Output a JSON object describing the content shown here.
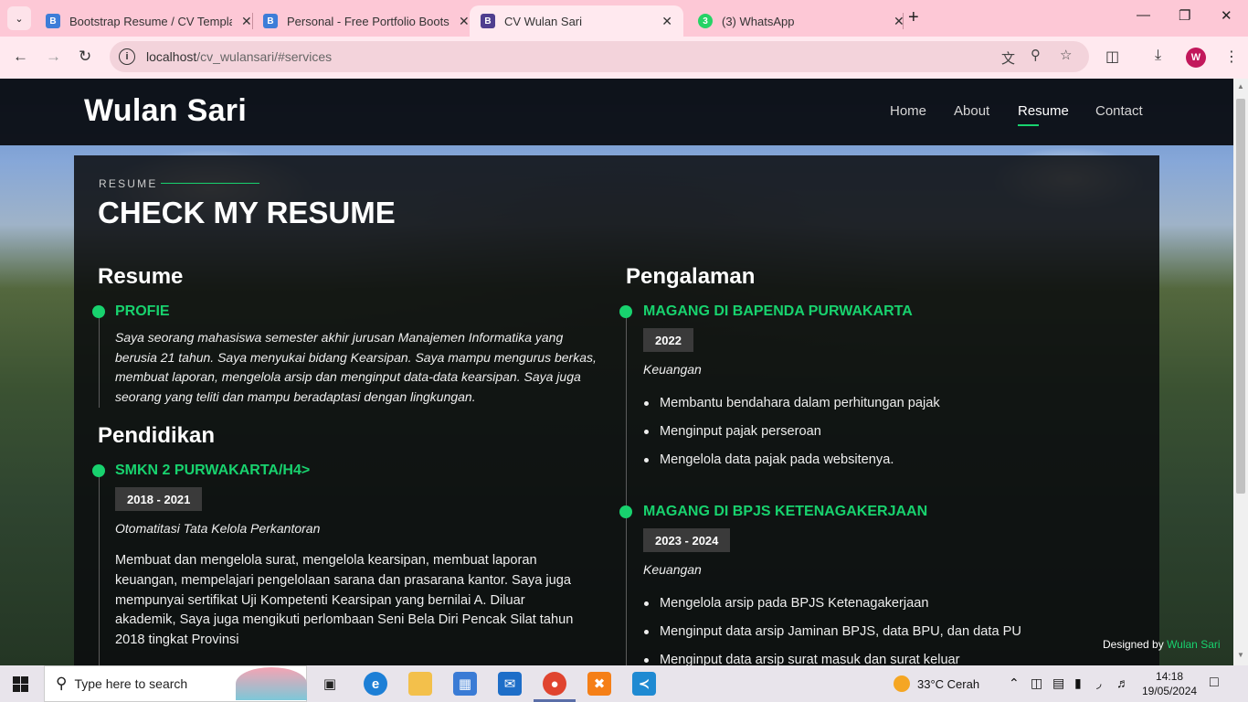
{
  "browser": {
    "tabs": [
      {
        "title": "Bootstrap Resume / CV Templat",
        "favicon": "B",
        "favicon_color": "#3d7dd8"
      },
      {
        "title": "Personal - Free Portfolio Bootst",
        "favicon": "B",
        "favicon_color": "#3d7dd8"
      },
      {
        "title": "CV Wulan Sari",
        "favicon": "B",
        "favicon_color": "#4f3e8f",
        "active": true
      },
      {
        "title": "(3) WhatsApp",
        "favicon": "3",
        "favicon_color": "#25d366"
      }
    ],
    "url_host": "localhost",
    "url_path": "/cv_wulansari/#services",
    "profile_initial": "W"
  },
  "site": {
    "logo": "Wulan Sari",
    "nav": [
      "Home",
      "About",
      "Resume",
      "Contact"
    ],
    "active_nav": "Resume",
    "accent_color": "#18d26e"
  },
  "resume": {
    "kicker": "RESUME",
    "title": "CHECK MY RESUME",
    "left": {
      "heading": "Resume",
      "profile": {
        "title": "PROFIE",
        "lines": [
          "Saya seorang mahasiswa semester akhir jurusan Manajemen Informatika yang",
          "berusia 21 tahun. Saya menyukai bidang Kearsipan. Saya mampu mengurus berkas,",
          "membuat laporan, mengelola arsip dan menginput data-data kearsipan. Saya juga",
          "seorang yang teliti dan mampu beradaptasi dengan lingkungan."
        ]
      },
      "education_heading": "Pendidikan",
      "education": {
        "title": "SMKN 2 PURWAKARTA/H4>",
        "date": "2018 - 2021",
        "subtitle": "Otomatitasi Tata Kelola Perkantoran",
        "lines": [
          "Membuat dan mengelola surat, mengelola kearsipan, membuat laporan",
          "keuangan, mempelajari pengelolaan sarana dan prasarana kantor. Saya juga",
          "mempunyai sertifikat Uji Kompetenti Kearsipan yang bernilai A. Diluar",
          "akademik, Saya juga mengikuti perlombaan Seni Bela Diri Pencak Silat tahun",
          "2018 tingkat Provinsi"
        ]
      }
    },
    "right": {
      "heading": "Pengalaman",
      "jobs": [
        {
          "title": "MAGANG DI BAPENDA PURWAKARTA",
          "date": "2022",
          "subtitle": "Keuangan",
          "bullets": [
            "Membantu bendahara dalam perhitungan pajak",
            "Menginput pajak perseroan",
            "Mengelola data pajak pada websitenya."
          ]
        },
        {
          "title": "MAGANG DI BPJS KETENAGAKERJAAN",
          "date": "2023 - 2024",
          "subtitle": "Keuangan",
          "bullets": [
            "Mengelola arsip pada BPJS Ketenagakerjaan",
            "Menginput data arsip Jaminan BPJS, data BPU, dan data PU",
            "Menginput data arsip surat masuk dan surat keluar"
          ]
        }
      ]
    },
    "credit_prefix": "Designed by",
    "credit_name": "Wulan Sari"
  },
  "taskbar": {
    "search_placeholder": "Type here to search",
    "weather": "33°C  Cerah",
    "time": "14:18",
    "date": "19/05/2024"
  }
}
